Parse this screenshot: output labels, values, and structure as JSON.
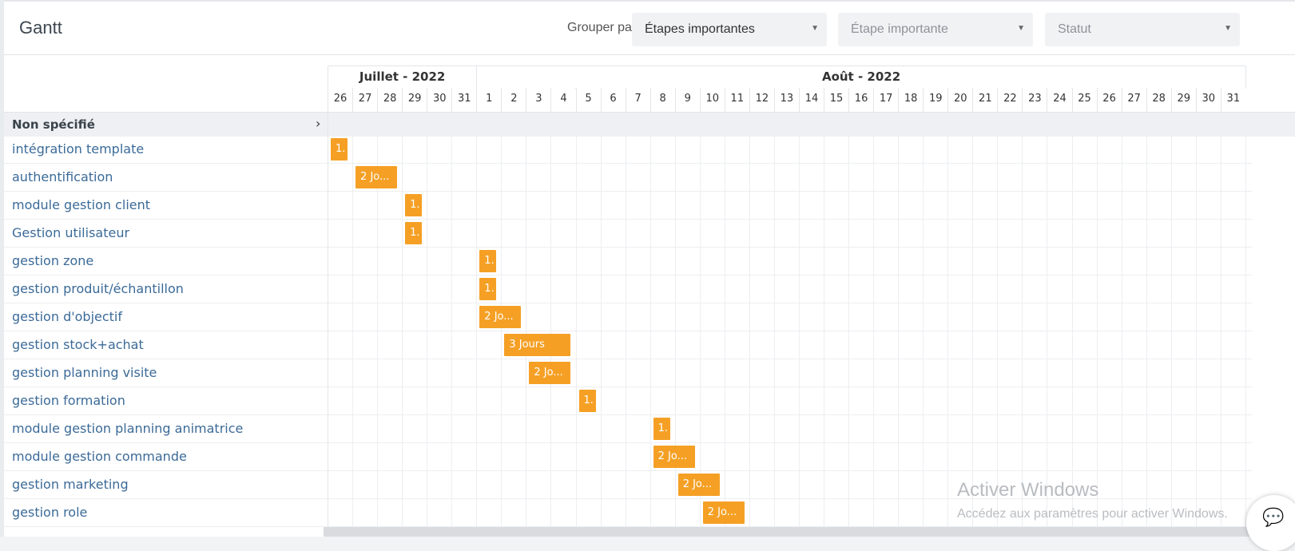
{
  "app": {
    "title": "Gantt"
  },
  "filters": {
    "group_label": "Grouper par :",
    "group_value": "Étapes importantes",
    "milestone_placeholder": "Étape importante",
    "status_placeholder": "Statut"
  },
  "timeline": {
    "months": [
      {
        "label": "Juillet - 2022",
        "days": [
          "26",
          "27",
          "28",
          "29",
          "30",
          "31"
        ]
      },
      {
        "label": "Août - 2022",
        "days": [
          "1",
          "2",
          "3",
          "4",
          "5",
          "6",
          "7",
          "8",
          "9",
          "10",
          "11",
          "12",
          "13",
          "14",
          "15",
          "16",
          "17",
          "18",
          "19",
          "20",
          "21",
          "22",
          "23",
          "24",
          "25",
          "26",
          "27",
          "28",
          "29",
          "30",
          "31"
        ]
      }
    ]
  },
  "group": {
    "name": "Non spécifié"
  },
  "tasks": [
    {
      "name": "intégration template",
      "start": "2022-07-26",
      "days": 1,
      "label": "1."
    },
    {
      "name": "authentification",
      "start": "2022-07-27",
      "days": 2,
      "label": "2 Jo..."
    },
    {
      "name": "module gestion client",
      "start": "2022-07-29",
      "days": 1,
      "label": "1."
    },
    {
      "name": "Gestion utilisateur",
      "start": "2022-07-29",
      "days": 1,
      "label": "1."
    },
    {
      "name": "gestion zone",
      "start": "2022-08-01",
      "days": 1,
      "label": "1."
    },
    {
      "name": "gestion produit/échantillon",
      "start": "2022-08-01",
      "days": 1,
      "label": "1."
    },
    {
      "name": "gestion d'objectif",
      "start": "2022-08-01",
      "days": 2,
      "label": "2 Jo..."
    },
    {
      "name": "gestion stock+achat",
      "start": "2022-08-02",
      "days": 3,
      "label": "3 Jours"
    },
    {
      "name": "gestion planning visite",
      "start": "2022-08-03",
      "days": 2,
      "label": "2 Jo..."
    },
    {
      "name": "gestion formation",
      "start": "2022-08-05",
      "days": 1,
      "label": "1."
    },
    {
      "name": "module gestion planning animatrice",
      "start": "2022-08-08",
      "days": 1,
      "label": "1."
    },
    {
      "name": "module gestion commande",
      "start": "2022-08-08",
      "days": 2,
      "label": "2 Jo..."
    },
    {
      "name": "gestion marketing",
      "start": "2022-08-09",
      "days": 2,
      "label": "2 Jo..."
    },
    {
      "name": "gestion role",
      "start": "2022-08-10",
      "days": 2,
      "label": "2 Jo..."
    }
  ],
  "watermark": {
    "line1": "Activer Windows",
    "line2": "Accédez aux paramètres pour activer Windows."
  },
  "colors": {
    "bar": "#f5a025",
    "task_text": "#3b6a98"
  },
  "icons": {
    "chat": "chat-icon",
    "chevron": "chevron-right-icon"
  }
}
